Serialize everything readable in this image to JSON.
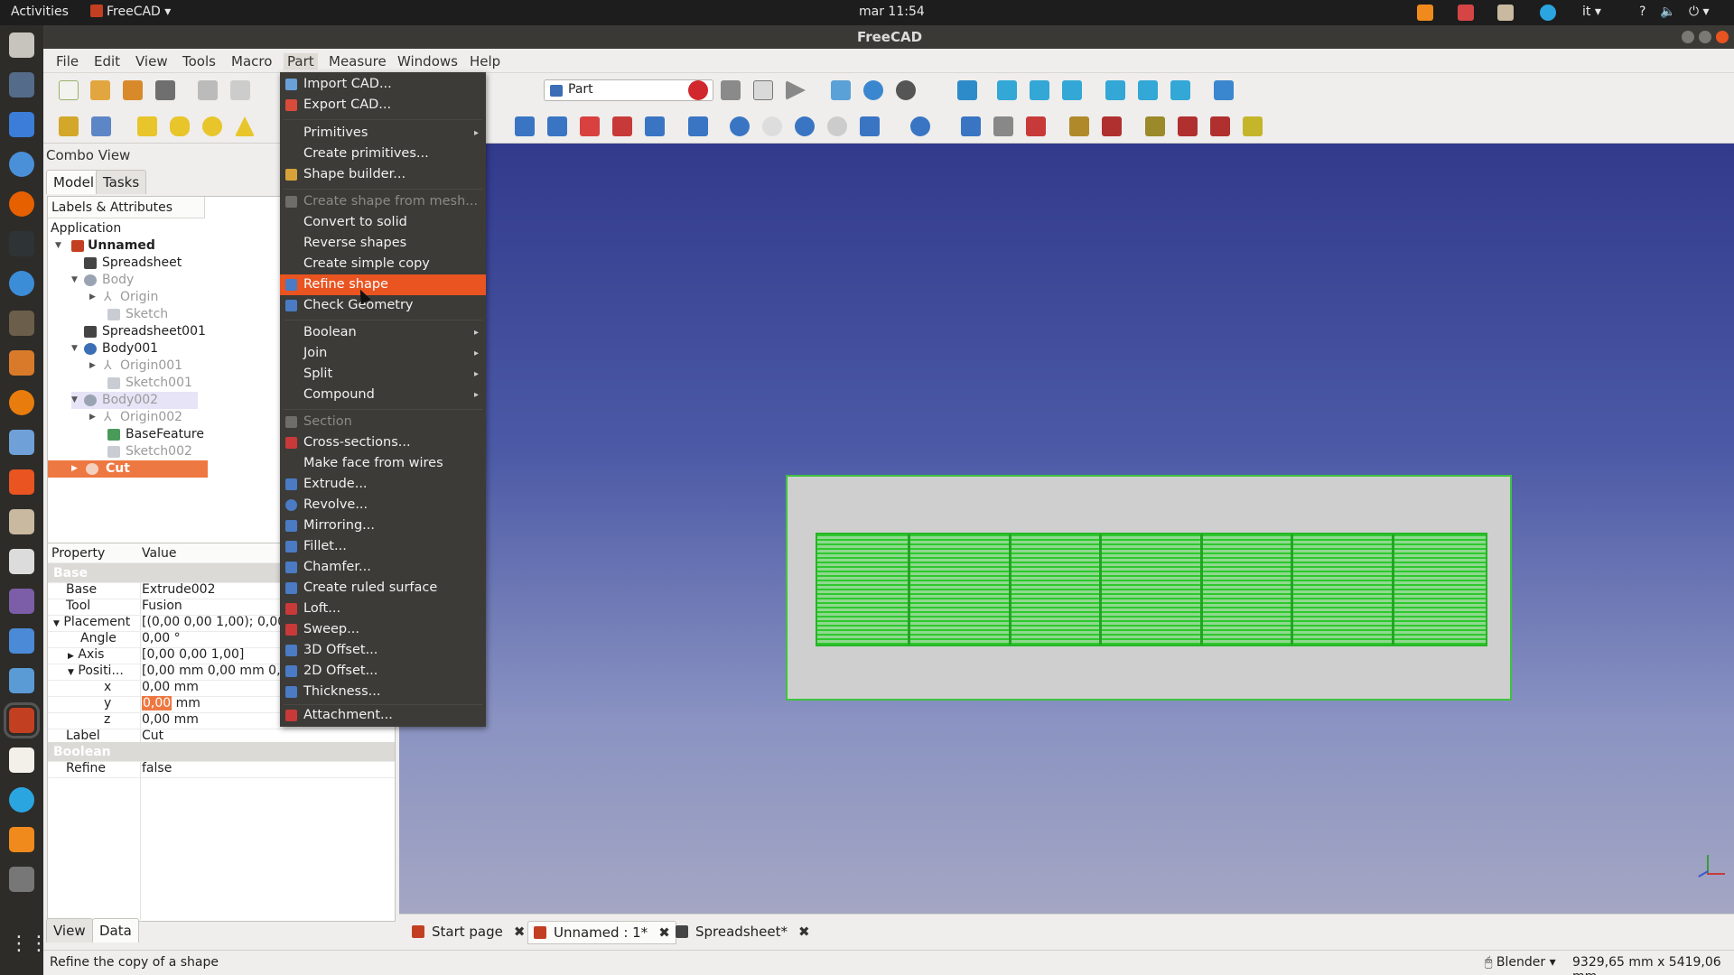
{
  "topbar": {
    "activities": "Activities",
    "app_name": "FreeCAD",
    "clock": "mar 11:54",
    "lang": "it",
    "help": "?"
  },
  "window": {
    "title": "FreeCAD"
  },
  "menubar": [
    "File",
    "Edit",
    "View",
    "Tools",
    "Macro",
    "Part",
    "Measure",
    "Windows",
    "Help"
  ],
  "toolbar": {
    "workbench": "Part"
  },
  "combo": {
    "title": "Combo View",
    "tabs": [
      "Model",
      "Tasks"
    ],
    "tree_header": "Labels & Attributes",
    "tree": {
      "application": "Application",
      "unnamed": "Unnamed",
      "spreadsheet": "Spreadsheet",
      "body": "Body",
      "origin": "Origin",
      "sketch": "Sketch",
      "spreadsheet001": "Spreadsheet001",
      "body001": "Body001",
      "origin001": "Origin001",
      "sketch001": "Sketch001",
      "body002": "Body002",
      "origin002": "Origin002",
      "basefeature": "BaseFeature",
      "sketch002": "Sketch002",
      "cut": "Cut"
    },
    "props": {
      "header_property": "Property",
      "header_value": "Value",
      "group_base": "Base",
      "base_name": "Base",
      "base_val": "Extrude002",
      "tool_name": "Tool",
      "tool_val": "Fusion",
      "placement_name": "Placement",
      "placement_val": "[(0,00 0,00 1,00); 0,00 °; ...",
      "angle_name": "Angle",
      "angle_val": "0,00 °",
      "axis_name": "Axis",
      "axis_val": "[0,00 0,00 1,00]",
      "position_name": "Positi...",
      "position_val": "[0,00 mm  0,00 mm  0,00 mm]",
      "x_name": "x",
      "x_val": "0,00 mm",
      "y_name": "y",
      "y_val_num": "0,00",
      "y_val_unit": "mm",
      "z_name": "z",
      "z_val": "0,00 mm",
      "label_name": "Label",
      "label_val": "Cut",
      "group_boolean": "Boolean",
      "refine_name": "Refine",
      "refine_val": "false"
    },
    "bottom_tabs": [
      "View",
      "Data"
    ]
  },
  "part_menu": {
    "import_cad": "Import CAD...",
    "export_cad": "Export CAD...",
    "primitives": "Primitives",
    "create_primitives": "Create primitives...",
    "shape_builder": "Shape builder...",
    "create_shape_from_mesh": "Create shape from mesh...",
    "convert_to_solid": "Convert to solid",
    "reverse_shapes": "Reverse shapes",
    "create_simple_copy": "Create simple copy",
    "refine_shape": "Refine shape",
    "check_geometry": "Check Geometry",
    "boolean": "Boolean",
    "join": "Join",
    "split": "Split",
    "compound": "Compound",
    "section": "Section",
    "cross_sections": "Cross-sections...",
    "make_face_from_wires": "Make face from wires",
    "extrude": "Extrude...",
    "revolve": "Revolve...",
    "mirroring": "Mirroring...",
    "fillet": "Fillet...",
    "chamfer": "Chamfer...",
    "create_ruled_surface": "Create ruled surface",
    "loft": "Loft...",
    "sweep": "Sweep...",
    "offset_3d": "3D Offset...",
    "offset_2d": "2D Offset...",
    "thickness": "Thickness...",
    "attachment": "Attachment..."
  },
  "doc_tabs": [
    "Start page",
    "Unnamed : 1*",
    "Spreadsheet*"
  ],
  "statusbar": {
    "message": "Refine the copy of a shape",
    "nav_style": "Blender",
    "dimensions": "9329,65 mm x 5419,06 mm"
  },
  "colors": {
    "accent": "#e95420",
    "selection": "#ee7841",
    "model_green": "#2ec82e"
  }
}
